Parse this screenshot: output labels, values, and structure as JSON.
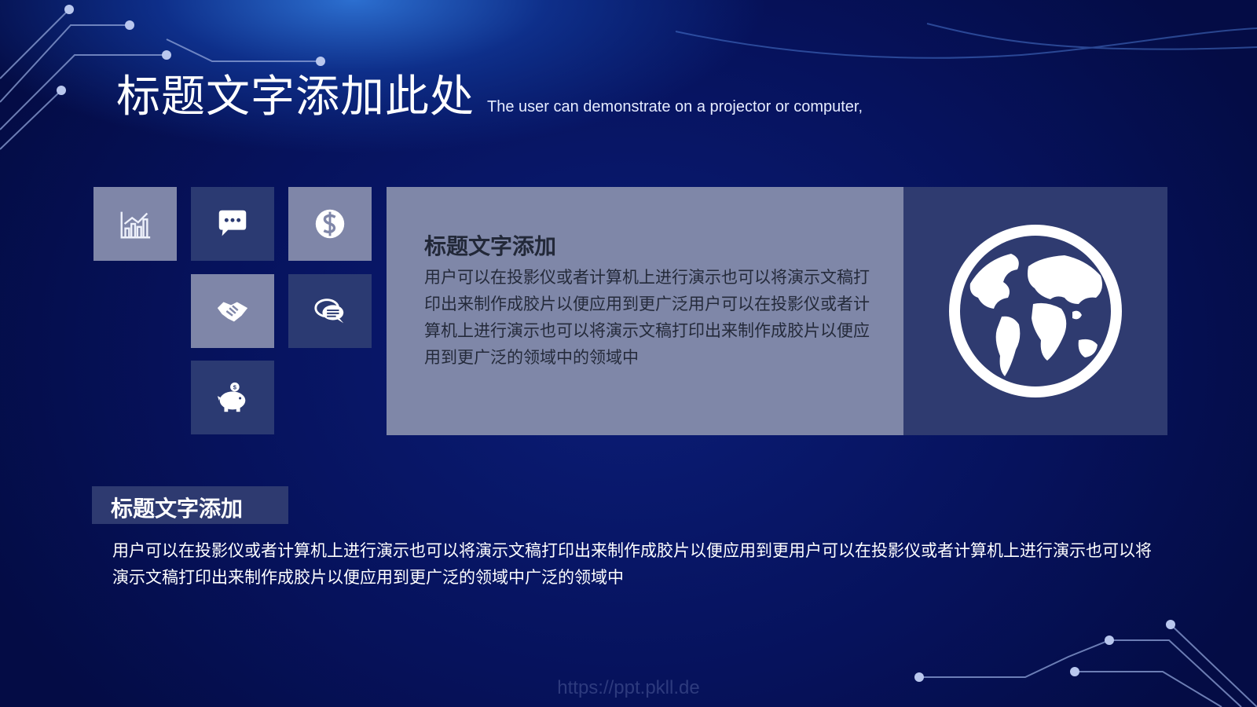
{
  "slide": {
    "title": "标题文字添加此处",
    "subtitle": "The user can demonstrate on a projector or computer,"
  },
  "icons": [
    {
      "name": "bar-chart-icon",
      "style": "light"
    },
    {
      "name": "chat-bubble-icon",
      "style": "dark"
    },
    {
      "name": "globe-dollar-icon",
      "style": "light"
    },
    {
      "name": "handshake-icon",
      "style": "light"
    },
    {
      "name": "speech-bubbles-icon",
      "style": "dark"
    },
    {
      "name": "piggy-bank-icon",
      "style": "dark"
    }
  ],
  "card": {
    "title": "标题文字添加",
    "body": "用户可以在投影仪或者计算机上进行演示也可以将演示文稿打印出来制作成胶片以便应用到更广泛用户可以在投影仪或者计算机上进行演示也可以将演示文稿打印出来制作成胶片以便应用到更广泛的领域中的领域中",
    "image_icon": "world-globe-icon"
  },
  "section": {
    "label": "标题文字添加",
    "body": "用户可以在投影仪或者计算机上进行演示也可以将演示文稿打印出来制作成胶片以便应用到更用户可以在投影仪或者计算机上进行演示也可以将演示文稿打印出来制作成胶片以便应用到更广泛的领域中广泛的领域中"
  },
  "watermark": "https://ppt.pkll.de",
  "colors": {
    "background": "#06125c",
    "tile_light": "#7f86a8",
    "tile_dark": "#2b3a72",
    "card": "#7f87a8",
    "globe_panel": "#2f3b70"
  }
}
